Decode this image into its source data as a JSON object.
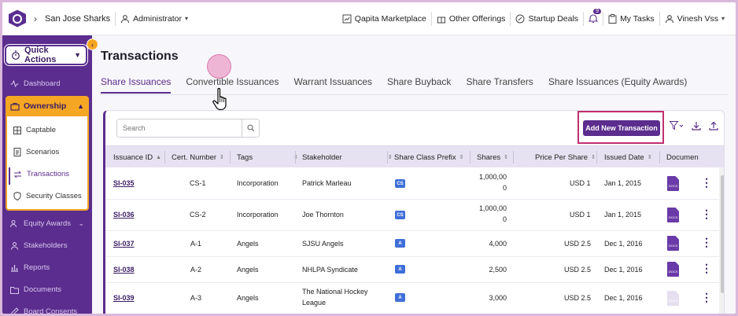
{
  "topbar": {
    "back_icon": "chevron-right-icon",
    "company": "San Jose Sharks",
    "role": "Administrator",
    "marketplace": "Qapita Marketplace",
    "offerings": "Other Offerings",
    "startup_deals": "Startup Deals",
    "notif_count": "9",
    "my_tasks": "My Tasks",
    "user": "Vinesh Vss"
  },
  "sidebar": {
    "quick_actions": "Quick Actions",
    "dashboard": "Dashboard",
    "ownership": "Ownership",
    "ownership_items": [
      "Captable",
      "Scenarios",
      "Transactions",
      "Security Classes"
    ],
    "active_item": "Transactions",
    "equity_awards": "Equity Awards",
    "stakeholders": "Stakeholders",
    "reports": "Reports",
    "documents": "Documents",
    "board_consents": "Board Consents",
    "accent_color": "#5b2d8e",
    "highlight_color": "#f5a623"
  },
  "main": {
    "title": "Transactions",
    "tabs": [
      {
        "label": "Share Issuances",
        "active": true
      },
      {
        "label": "Convertible Issuances",
        "active": false
      },
      {
        "label": "Warrant Issuances",
        "active": false
      },
      {
        "label": "Share Buyback",
        "active": false
      },
      {
        "label": "Share Transfers",
        "active": false
      },
      {
        "label": "Share Issuances (Equity Awards)",
        "active": false
      }
    ],
    "search_placeholder": "Search",
    "add_button": "Add New Transaction",
    "columns": [
      "Issuance ID",
      "Cert. Number",
      "Tags",
      "Stakeholder",
      "Share Class Prefix",
      "Shares",
      "Price Per Share",
      "Issued Date",
      "Documen"
    ],
    "rows": [
      {
        "id": "SI-035",
        "cert": "CS-1",
        "tag": "Incorporation",
        "stakeholder": "Patrick Marleau",
        "stakeholder2": "",
        "prefix": "CS",
        "shares": "1,000,00",
        "shares2": "0",
        "price": "USD 1",
        "date": "Jan 1, 2015",
        "doc_faded": false
      },
      {
        "id": "SI-036",
        "cert": "CS-2",
        "tag": "Incorporation",
        "stakeholder": "Joe Thornton",
        "stakeholder2": "",
        "prefix": "CS",
        "shares": "1,000,00",
        "shares2": "0",
        "price": "USD 1",
        "date": "Jan 1, 2015",
        "doc_faded": false
      },
      {
        "id": "SI-037",
        "cert": "A-1",
        "tag": "Angels",
        "stakeholder": "SJSU Angels",
        "stakeholder2": "",
        "prefix": "A",
        "shares": "4,000",
        "shares2": "",
        "price": "USD 2.5",
        "date": "Dec 1, 2016",
        "doc_faded": false
      },
      {
        "id": "SI-038",
        "cert": "A-2",
        "tag": "Angels",
        "stakeholder": "NHLPA Syndicate",
        "stakeholder2": "",
        "prefix": "A",
        "shares": "2,500",
        "shares2": "",
        "price": "USD 2.5",
        "date": "Dec 1, 2016",
        "doc_faded": false
      },
      {
        "id": "SI-039",
        "cert": "A-3",
        "tag": "Angels",
        "stakeholder": "The National Hockey",
        "stakeholder2": "League",
        "prefix": "A",
        "shares": "3,000",
        "shares2": "",
        "price": "USD 2.5",
        "date": "Dec 1, 2016",
        "doc_faded": true
      }
    ],
    "doc_icon_text": "DOCS"
  }
}
